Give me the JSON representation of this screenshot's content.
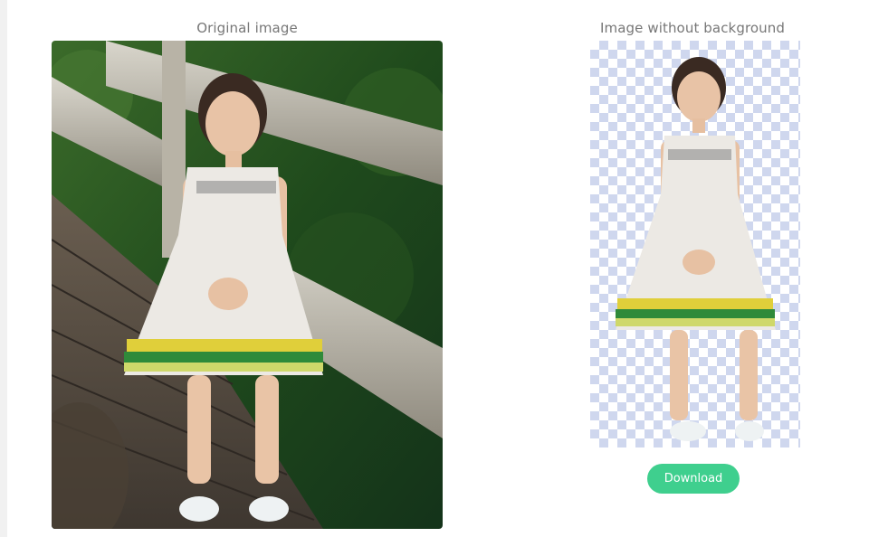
{
  "captions": {
    "original": "Original image",
    "without_background": "Image without background"
  },
  "actions": {
    "download_label": "Download"
  },
  "colors": {
    "accent_button": "#3fcf8e",
    "caption_text": "#777777",
    "checker_blue": "#cfd7ee"
  }
}
